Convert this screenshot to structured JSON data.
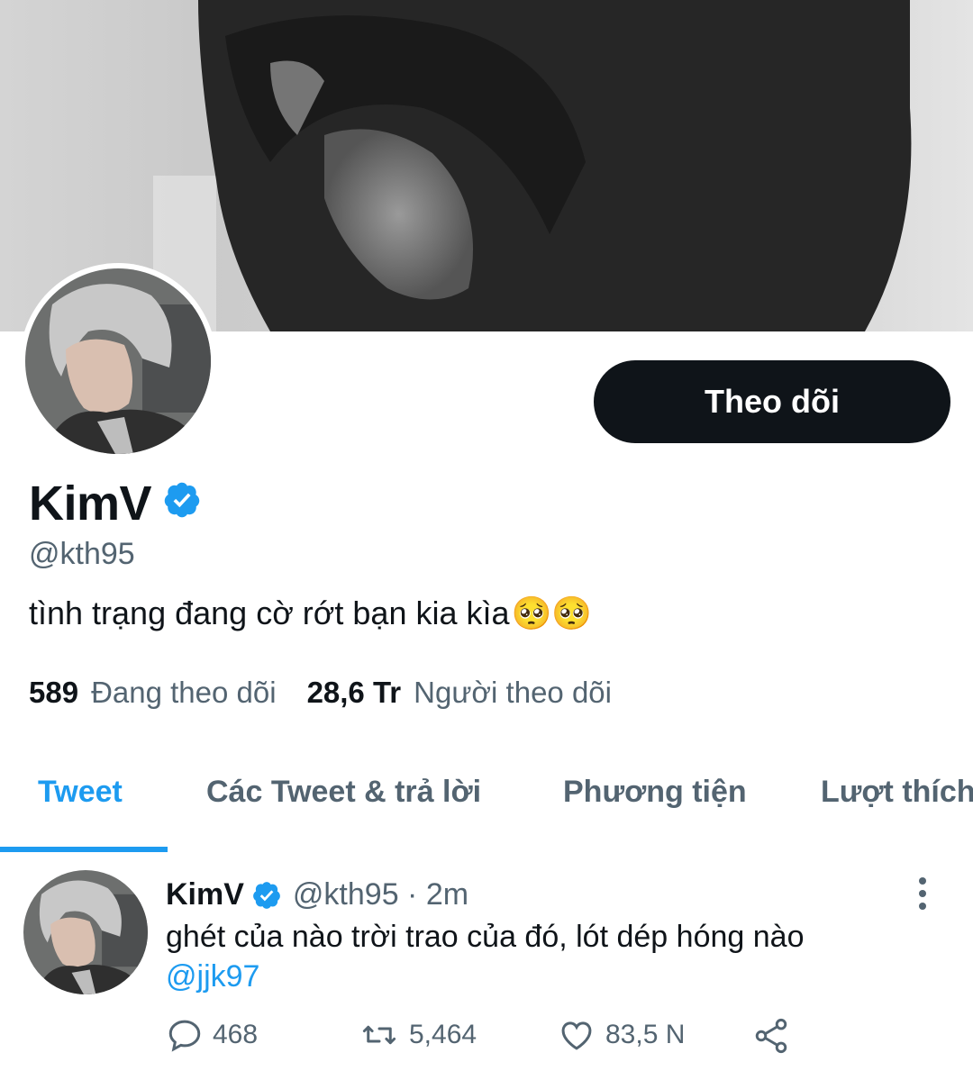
{
  "profile": {
    "display_name": "KimV",
    "handle": "@kth95",
    "bio": "tình trạng đang cờ rớt bạn kia kìa",
    "bio_emoji": "🥺🥺",
    "verified": true,
    "follow_button_label": "Theo dõi",
    "following_count": "589",
    "following_label": "Đang theo dõi",
    "followers_count": "28,6 Tr",
    "followers_label": "Người theo dõi"
  },
  "tabs": [
    {
      "label": "Tweet",
      "active": true
    },
    {
      "label": "Các Tweet & trả lời",
      "active": false
    },
    {
      "label": "Phương tiện",
      "active": false
    },
    {
      "label": "Lượt thích",
      "active": false
    }
  ],
  "tweet": {
    "name": "KimV",
    "handle_time": "@kth95 · 2m",
    "text": "ghét của nào trời trao của đó, lót dép hóng nào",
    "mention": "@jjk97",
    "replies": "468",
    "retweets": "5,464",
    "likes": "83,5 N"
  },
  "colors": {
    "accent": "#1d9bf0",
    "text_primary": "#0f1419",
    "text_secondary": "#536471",
    "button_dark": "#0f1419"
  },
  "icons": [
    "verified-badge-icon",
    "more-vertical-icon",
    "reply-icon",
    "retweet-icon",
    "like-icon",
    "share-icon"
  ]
}
